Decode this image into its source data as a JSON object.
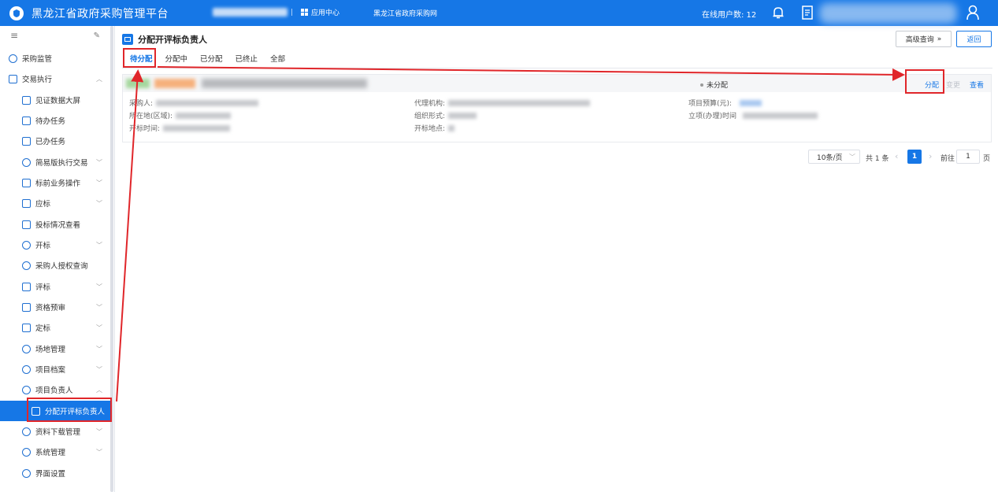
{
  "header": {
    "app_title": "黑龙江省政府采购管理平台",
    "app_center_label": "应用中心",
    "portal_link": "黑龙江省政府采购网",
    "online_users": "在线用户数: 12",
    "separator": "|"
  },
  "sidebar": {
    "items": [
      {
        "label": "采购监管",
        "icon": "shield-icon",
        "chevron": ""
      },
      {
        "label": "交易执行",
        "icon": "transaction-icon",
        "chevron": "^"
      },
      {
        "label": "见证数据大屏",
        "icon": "screen-icon",
        "chevron": ""
      },
      {
        "label": "待办任务",
        "icon": "todo-icon",
        "chevron": ""
      },
      {
        "label": "已办任务",
        "icon": "done-icon",
        "chevron": ""
      },
      {
        "label": "简易版执行交易",
        "icon": "simple-trade-icon",
        "chevron": "v"
      },
      {
        "label": "标前业务操作",
        "icon": "cart-icon",
        "chevron": "v"
      },
      {
        "label": "应标",
        "icon": "bid-icon",
        "chevron": "v"
      },
      {
        "label": "投标情况查看",
        "icon": "bid-view-icon",
        "chevron": ""
      },
      {
        "label": "开标",
        "icon": "gavel-icon",
        "chevron": "v"
      },
      {
        "label": "采购人授权查询",
        "icon": "auth-query-icon",
        "chevron": ""
      },
      {
        "label": "评标",
        "icon": "evaluate-icon",
        "chevron": "v"
      },
      {
        "label": "资格预审",
        "icon": "prequal-icon",
        "chevron": "v"
      },
      {
        "label": "定标",
        "icon": "award-icon",
        "chevron": "v"
      },
      {
        "label": "场地管理",
        "icon": "venue-icon",
        "chevron": "v"
      },
      {
        "label": "项目档案",
        "icon": "archive-icon",
        "chevron": "v"
      },
      {
        "label": "项目负责人",
        "icon": "manager-icon",
        "chevron": "^"
      },
      {
        "label": "分配开评标负责人",
        "icon": "assign-icon",
        "chevron": ""
      },
      {
        "label": "资料下载管理",
        "icon": "link-icon",
        "chevron": "v"
      },
      {
        "label": "系统管理",
        "icon": "system-icon",
        "chevron": "v"
      },
      {
        "label": "界面设置",
        "icon": "settings-icon",
        "chevron": ""
      }
    ]
  },
  "main": {
    "title": "分配开评标负责人",
    "advanced_search": "高级查询",
    "back": "返回",
    "tabs": [
      "待分配",
      "分配中",
      "已分配",
      "已终止",
      "全部"
    ],
    "record": {
      "status": "未分配",
      "actions": {
        "assign": "分配",
        "change": "变更",
        "view": "查看"
      },
      "fields": {
        "purchaser": "采购人:",
        "agency": "代理机构:",
        "budget": "项目预算(元):",
        "region": "所在地(区域):",
        "org_form": "组织形式:",
        "approval_time": "立项(办理)时间",
        "open_time": "开标时间:",
        "open_place": "开标地点:"
      }
    },
    "pagination": {
      "page_size": "10条/页",
      "total": "共 1 条",
      "current_page": "1",
      "goto_label": "前往",
      "goto_value": "1",
      "page_suffix": "页"
    }
  },
  "colors": {
    "primary": "#1677e6",
    "annotation": "#e0262a"
  }
}
